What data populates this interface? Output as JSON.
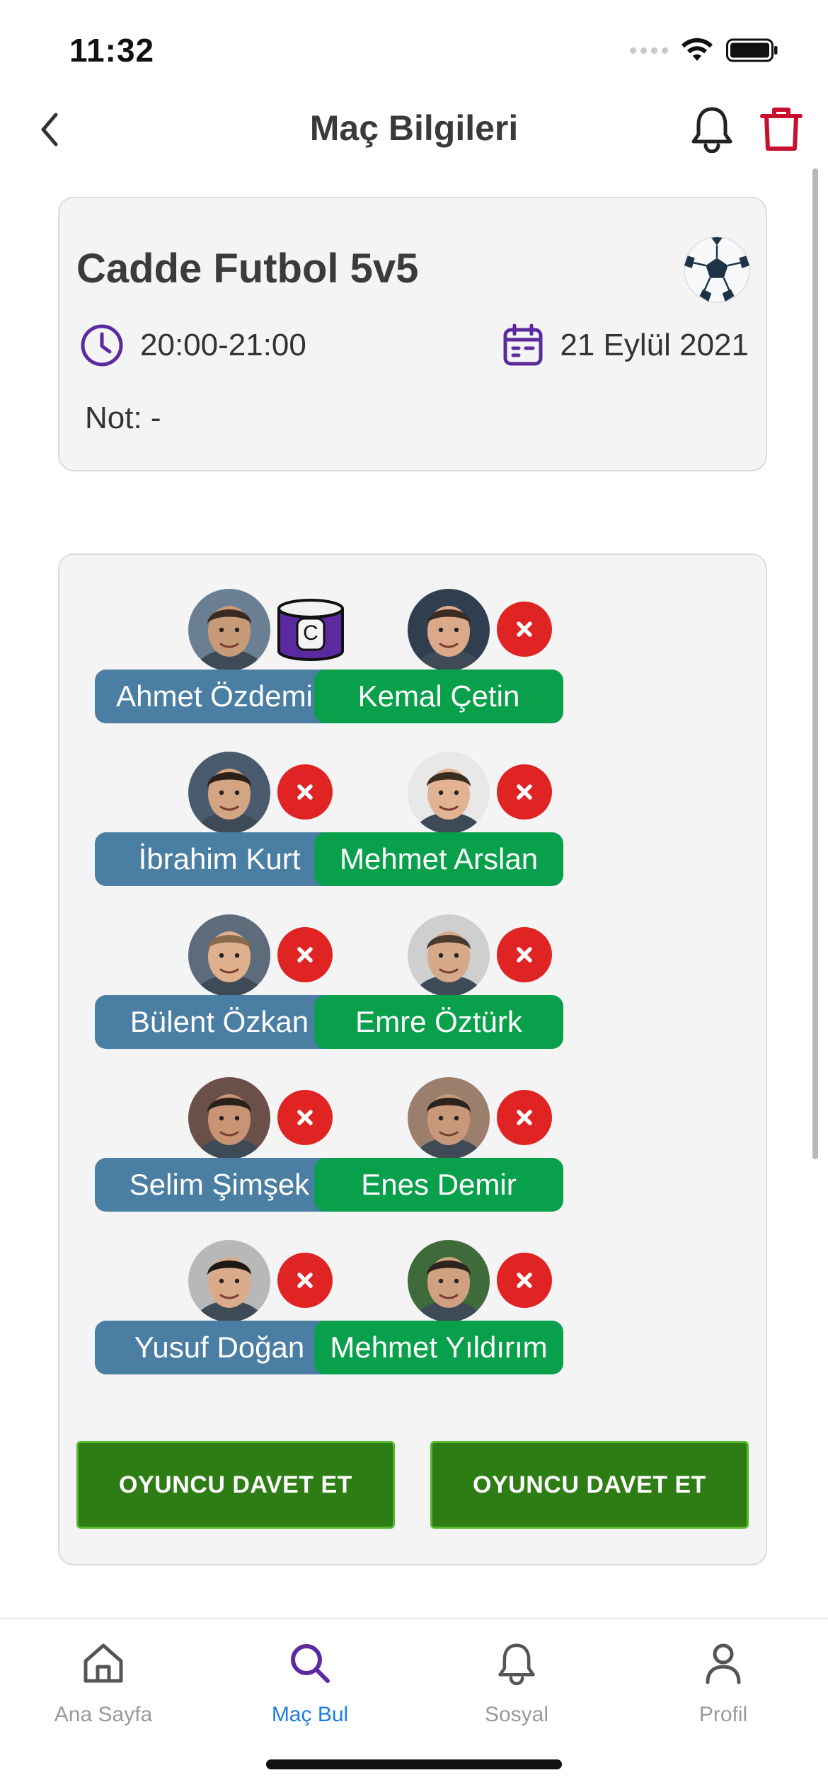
{
  "status_bar": {
    "time": "11:32"
  },
  "header": {
    "title": "Maç Bilgileri"
  },
  "match": {
    "title": "Cadde Futbol 5v5",
    "time": "20:00-21:00",
    "date": "21 Eylül 2021",
    "note": "Not: -",
    "captain_label": "C"
  },
  "team_a": [
    {
      "name": "Ahmet Özdemir",
      "captain": true
    },
    {
      "name": "İbrahim Kurt"
    },
    {
      "name": "Bülent Özkan"
    },
    {
      "name": "Selim Şimşek"
    },
    {
      "name": "Yusuf Doğan"
    }
  ],
  "team_b": [
    {
      "name": "Kemal Çetin"
    },
    {
      "name": "Mehmet Arslan"
    },
    {
      "name": "Emre Öztürk"
    },
    {
      "name": "Enes Demir"
    },
    {
      "name": "Mehmet Yıldırım"
    }
  ],
  "actions": {
    "invite_left": "OYUNCU DAVET ET",
    "invite_right": "OYUNCU DAVET ET"
  },
  "tabs": [
    {
      "label": "Ana Sayfa",
      "icon": "home-icon"
    },
    {
      "label": "Maç Bul",
      "icon": "search-icon",
      "active": true
    },
    {
      "label": "Sosyal",
      "icon": "bell-icon"
    },
    {
      "label": "Profil",
      "icon": "person-icon"
    }
  ],
  "colors": {
    "team_a_pill": "#4a7ea3",
    "team_b_pill": "#08a04b",
    "invite_button": "#2e7d14",
    "remove_button": "#e02424",
    "accent_purple": "#5b2a9e",
    "active_tab": "#1e7ce0"
  }
}
